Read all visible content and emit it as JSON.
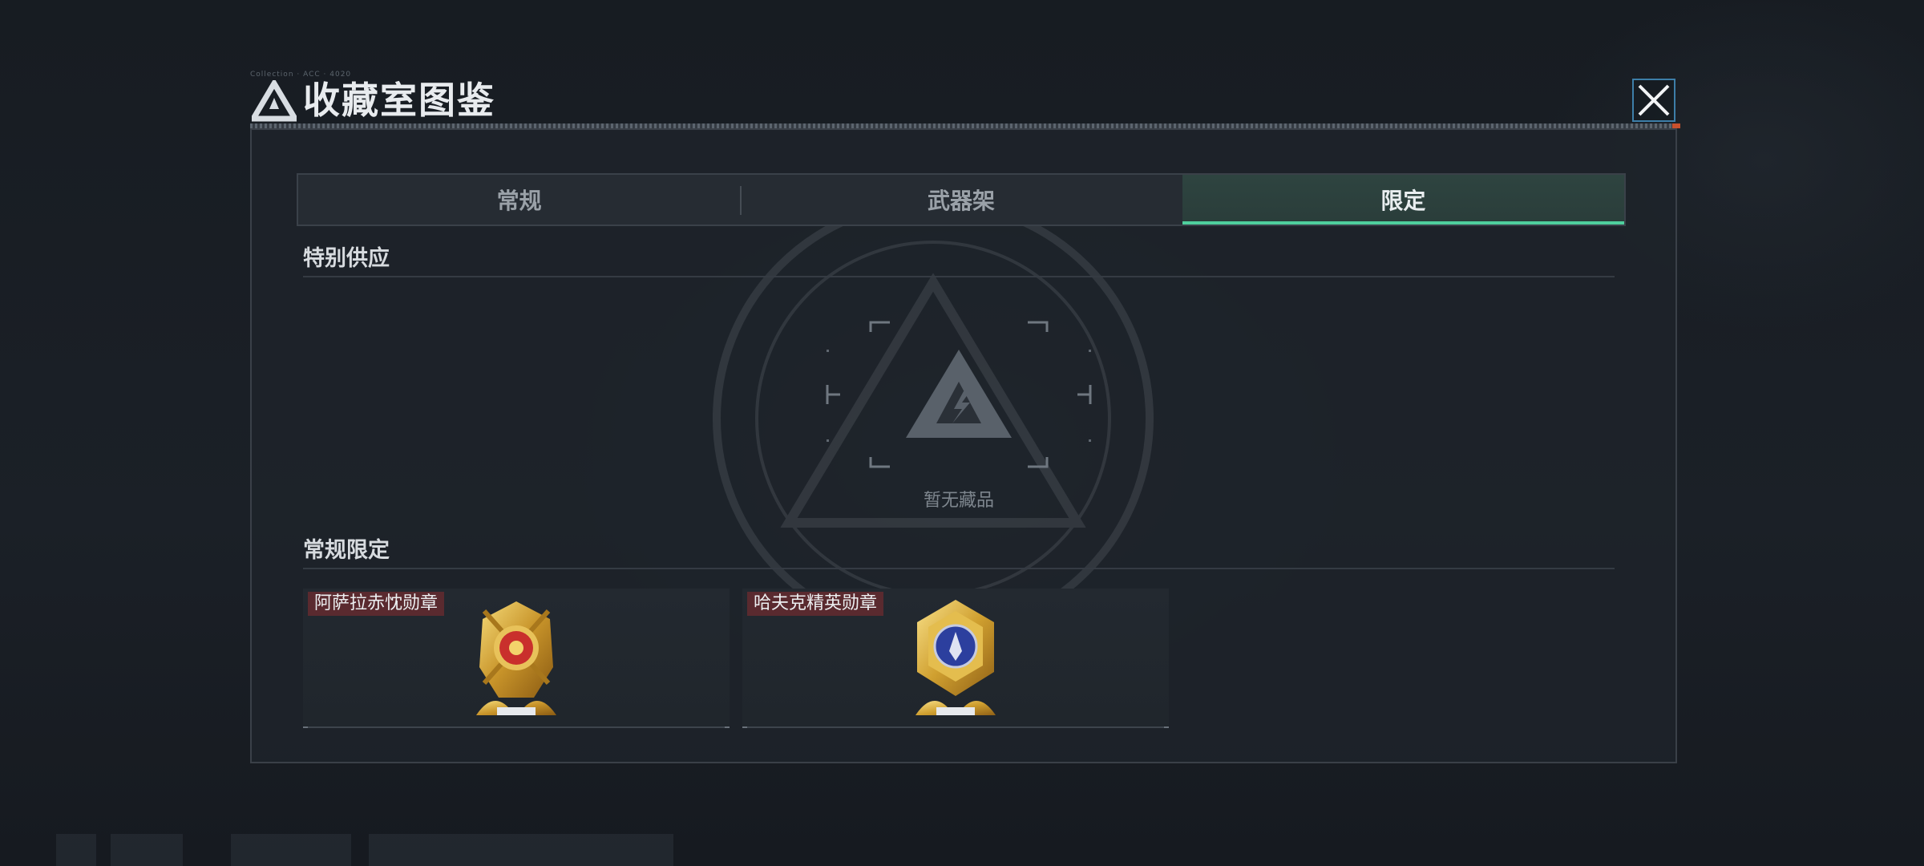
{
  "dialog": {
    "title": "收藏室图鉴",
    "header_tiny_text": "Collection · ACC · 4020"
  },
  "tabs": [
    {
      "label": "常规",
      "active": false
    },
    {
      "label": "武器架",
      "active": false
    },
    {
      "label": "限定",
      "active": true
    }
  ],
  "sections": {
    "special": {
      "title": "特别供应",
      "empty_text": "暂无藏品"
    },
    "limited": {
      "title": "常规限定",
      "items": [
        {
          "label": "阿萨拉赤忱勋章",
          "gem_color": "#c9302c"
        },
        {
          "label": "哈夫克精英勋章",
          "gem_color": "#2c3f9e"
        }
      ]
    }
  },
  "colors": {
    "accent": "#4fcf9d",
    "label_bg": "#5a2a2f",
    "panel_bg": "#1e232a"
  }
}
